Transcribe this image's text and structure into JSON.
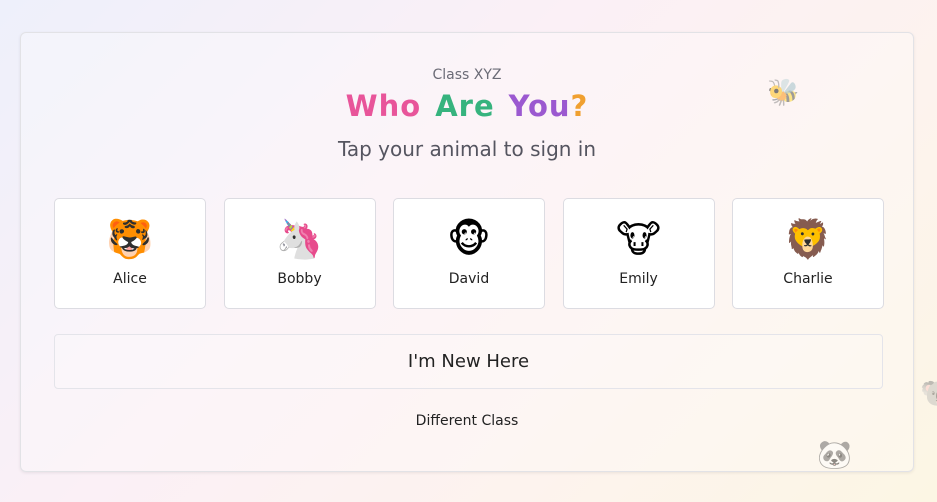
{
  "header": {
    "class_label": "Class XYZ",
    "title_words": [
      "Who",
      "Are",
      "You?"
    ],
    "tagline": "Tap your animal to sign in"
  },
  "animals": [
    {
      "name": "Alice",
      "icon": "tiger-face-icon",
      "glyph": "🐯"
    },
    {
      "name": "Bobby",
      "icon": "unicorn-face-icon",
      "glyph": "🦄"
    },
    {
      "name": "David",
      "icon": "monkey-face-icon",
      "glyph": "🐵"
    },
    {
      "name": "Emily",
      "icon": "cow-face-icon",
      "glyph": "🐮"
    },
    {
      "name": "Charlie",
      "icon": "lion-face-icon",
      "glyph": "🦁"
    }
  ],
  "actions": {
    "new_here": "I'm New Here",
    "different_class": "Different Class"
  },
  "decorations": [
    {
      "icon": "bee-icon",
      "glyph": "🐝"
    },
    {
      "icon": "panda-icon",
      "glyph": "🐼"
    },
    {
      "icon": "koala-icon",
      "glyph": "🐨"
    }
  ],
  "colors": {
    "title_pink": "#e8559a",
    "title_green": "#36b37e",
    "title_purple": "#9b59d0",
    "title_orange": "#f0a030"
  }
}
